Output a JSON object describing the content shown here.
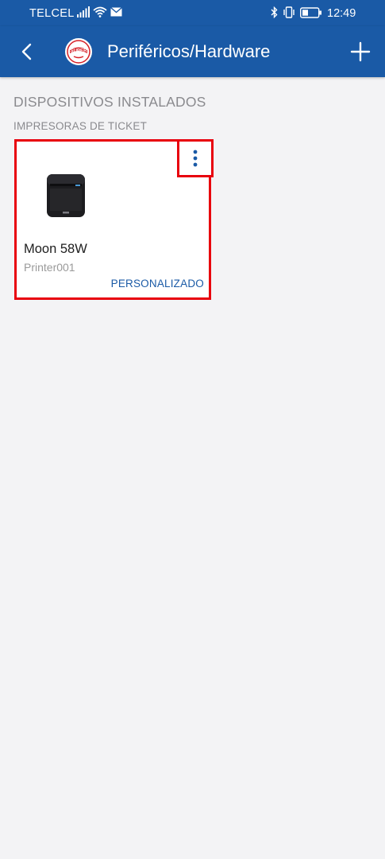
{
  "status_bar": {
    "carrier": "TELCEL",
    "time": "12:49",
    "icons": [
      "signal-icon",
      "wifi-icon",
      "mail-icon",
      "bluetooth-icon",
      "vibrate-icon",
      "battery-icon"
    ]
  },
  "app_bar": {
    "back_icon": "chevron-left-icon",
    "logo_text": "SUPER",
    "title": "Periféricos/Hardware",
    "add_icon": "plus-icon"
  },
  "colors": {
    "primary": "#1a5aa6",
    "highlight": "#e8000d",
    "background": "#f3f3f5"
  },
  "section": {
    "title": "DISPOSITIVOS INSTALADOS",
    "subsection": "IMPRESORAS DE TICKET"
  },
  "devices": [
    {
      "name": "Moon 58W",
      "id": "Printer001",
      "type": "PERSONALIZADO",
      "menu_icon": "more-vert-icon",
      "image": "receipt-printer-icon"
    }
  ]
}
